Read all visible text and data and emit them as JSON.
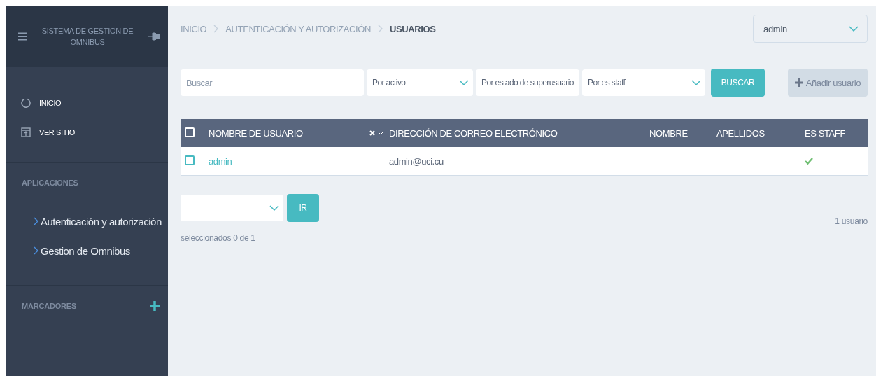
{
  "sidebar": {
    "title": "SISTEMA DE GESTION DE OMNIBUS",
    "nav": [
      {
        "kind": "home",
        "label": "INICIO"
      },
      {
        "kind": "site",
        "label": "VER SITIO"
      }
    ],
    "apps_heading": "APLICACIONES",
    "apps": [
      "Autenticación y autorización",
      "Gestion de Omnibus"
    ],
    "bookmarks_heading": "MARCADORES"
  },
  "breadcrumbs": [
    {
      "label": "INICIO",
      "current": false
    },
    {
      "label": "AUTENTICACIÓN Y AUTORIZACIÓN",
      "current": false
    },
    {
      "label": "USUARIOS",
      "current": true
    }
  ],
  "user_menu": {
    "value": "admin"
  },
  "search": {
    "placeholder": "Buscar"
  },
  "filters": [
    "Por activo",
    "Por estado de superusuario",
    "Por es staff"
  ],
  "search_button": "BUSCAR",
  "add_button": "Añadir usuario",
  "table": {
    "columns": [
      "NOMBRE DE USUARIO",
      "DIRECCIÓN DE CORREO ELECTRÓNICO",
      "NOMBRE",
      "APELLIDOS",
      "ES STAFF"
    ],
    "all_checked": false,
    "rows": [
      {
        "checked": false,
        "username": "admin",
        "email": "admin@uci.cu",
        "is_staff": true
      }
    ]
  },
  "actions": {
    "value": "---------",
    "go_button": "IR",
    "selected_count": "seleccionados 0 de 1",
    "result_count": "1 usuario"
  }
}
